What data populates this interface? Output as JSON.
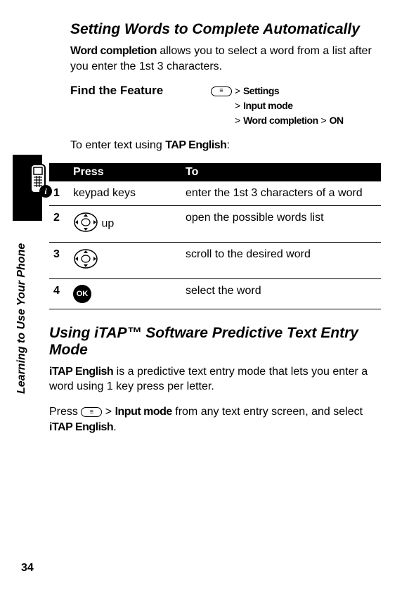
{
  "sideLabel": "Learning to Use Your Phone",
  "pageNumber": "34",
  "section1": {
    "title": "Setting Words to Complete Automatically",
    "introPrefix": "Word completion",
    "introRest": " allows you to select a word from a list after you enter the 1st 3 characters.",
    "featureLabel": "Find the Feature",
    "pathLine1a": " > ",
    "pathLine1b": "Settings",
    "pathLine2a": "> ",
    "pathLine2b": "Input mode",
    "pathLine3a": "> ",
    "pathLine3b": "Word completion",
    "pathLine3c": " > ",
    "pathLine3d": "ON",
    "enterTextPre": "To enter text using ",
    "enterTextMode": "TAP English",
    "enterTextPost": ":"
  },
  "table": {
    "headNum": " ",
    "headPress": "Press",
    "headTo": "To",
    "rows": [
      {
        "num": "1",
        "press": "keypad keys",
        "to": "enter the 1st 3 characters of a word",
        "icon": "none",
        "extra": ""
      },
      {
        "num": "2",
        "press": "",
        "to": "open the possible words list",
        "icon": "nav",
        "extra": " up"
      },
      {
        "num": "3",
        "press": "",
        "to": "scroll to the desired word",
        "icon": "nav",
        "extra": ""
      },
      {
        "num": "4",
        "press": "",
        "to": "select the word",
        "icon": "ok",
        "extra": ""
      }
    ],
    "okLabel": "OK"
  },
  "section2": {
    "title": "Using iTAP™ Software Predictive Text Entry Mode",
    "p1Prefix": "iTAP English",
    "p1Rest": " is a predictive text entry mode that lets you enter a word using 1 key press per letter.",
    "p2a": "Press ",
    "p2b": " > ",
    "p2c": "Input mode",
    "p2d": " from any text entry screen, and select ",
    "p2e": "iTAP English",
    "p2f": "."
  }
}
